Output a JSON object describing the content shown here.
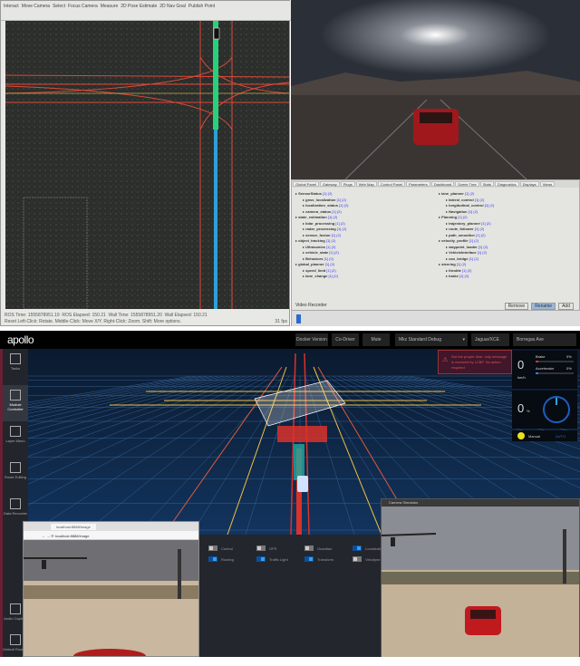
{
  "rviz": {
    "toolbar": [
      "Interact",
      "Move Camera",
      "Select",
      "Focus Camera",
      "Measure",
      "2D Pose Estimate",
      "2D Nav Goal",
      "Publish Point"
    ],
    "status": [
      "ROS Time: 1555878951.19",
      "ROS Elapsed: 150.21",
      "Wall Time: 1555878951.20",
      "Wall Elapsed: 150.21"
    ],
    "hint": "Reset  Left-Click: Rotate.  Middle-Click: Move X/Y.  Right-Click: Zoom.  Shift: More options.",
    "fps": "31 fps"
  },
  "tree_panel": {
    "title": "Plot Juggler",
    "tabs": [
      "Global Panel",
      "Gateway",
      "Plugs",
      "Web Map",
      "Control Panel",
      "Parameters",
      "Dashboard",
      "Scene Tree",
      "Stats",
      "Diagnostics",
      "Displays",
      "Views"
    ],
    "left_items": [
      "SensorStatus",
      "gnss_localization",
      "localization_status",
      "camera_status",
      "state_estimation",
      "lidar_processing",
      "radar_processing",
      "sensor_fusion",
      "object_tracking",
      "Ultrasonics",
      "vehicle_state",
      "Behaviors",
      "global_planner",
      "speed_limit",
      "lane_change"
    ],
    "right_items": [
      "lane_planner",
      "lateral_control",
      "longitudinal_control",
      "Navigation",
      "Planning",
      "trajectory_planner",
      "route_follower",
      "path_smoother",
      "velocity_profile",
      "waypoint_loader",
      "VehicleInterface",
      "can_bridge",
      "steering",
      "throttle",
      "brake"
    ],
    "buttons": [
      "Remove",
      "Rename",
      "Add"
    ],
    "footer": "Video Recorder"
  },
  "dreamview": {
    "logo": "apollo",
    "header": {
      "buttons": [
        "Docker Version",
        "Co-Driver",
        "Mute"
      ],
      "mode": "Mkz Standard Debug",
      "vehicle": "Jaguar/XCE",
      "map": "Borregas Ave"
    },
    "sidebar": [
      {
        "label": "Tasks",
        "active": false
      },
      {
        "label": "Module Controller",
        "active": true
      },
      {
        "label": "Layer Menu",
        "active": false
      },
      {
        "label": "Route Editing",
        "active": false
      },
      {
        "label": "Data Recorder",
        "active": false
      },
      {
        "label": "Audio Capture",
        "active": false
      },
      {
        "label": "Default Routing",
        "active": false
      }
    ],
    "alert": "Not the proper time, only message is received by LCBP. No action required",
    "dashboard": {
      "speed": "0",
      "speed_unit": "km/h",
      "brake_label": "Brake",
      "brake_pct": "0%",
      "accel_label": "Accelerator",
      "accel_pct": "0%",
      "steer": "0",
      "steer_unit": "%",
      "signal_label": "Manual",
      "mode_label": "AUTO"
    },
    "modules": [
      {
        "label": "Control",
        "on": false
      },
      {
        "label": "GPS",
        "on": false
      },
      {
        "label": "Guardian",
        "on": false
      },
      {
        "label": "Localization",
        "on": true
      },
      {
        "label": "Routing",
        "on": true
      },
      {
        "label": "Traffic Light",
        "on": true
      },
      {
        "label": "Transform",
        "on": true
      },
      {
        "label": "Velodyne",
        "on": false
      }
    ],
    "browser": {
      "tab": "localhost:8888/image",
      "url": "localhost:8888/image"
    },
    "camera_window_title": "Camera Simulator"
  },
  "colors": {
    "apollo_bg": "#0d1b2e",
    "sidebar_accent": "#6a1f33",
    "toggle_on": "#2aa3ff",
    "route": "#d9322a"
  }
}
